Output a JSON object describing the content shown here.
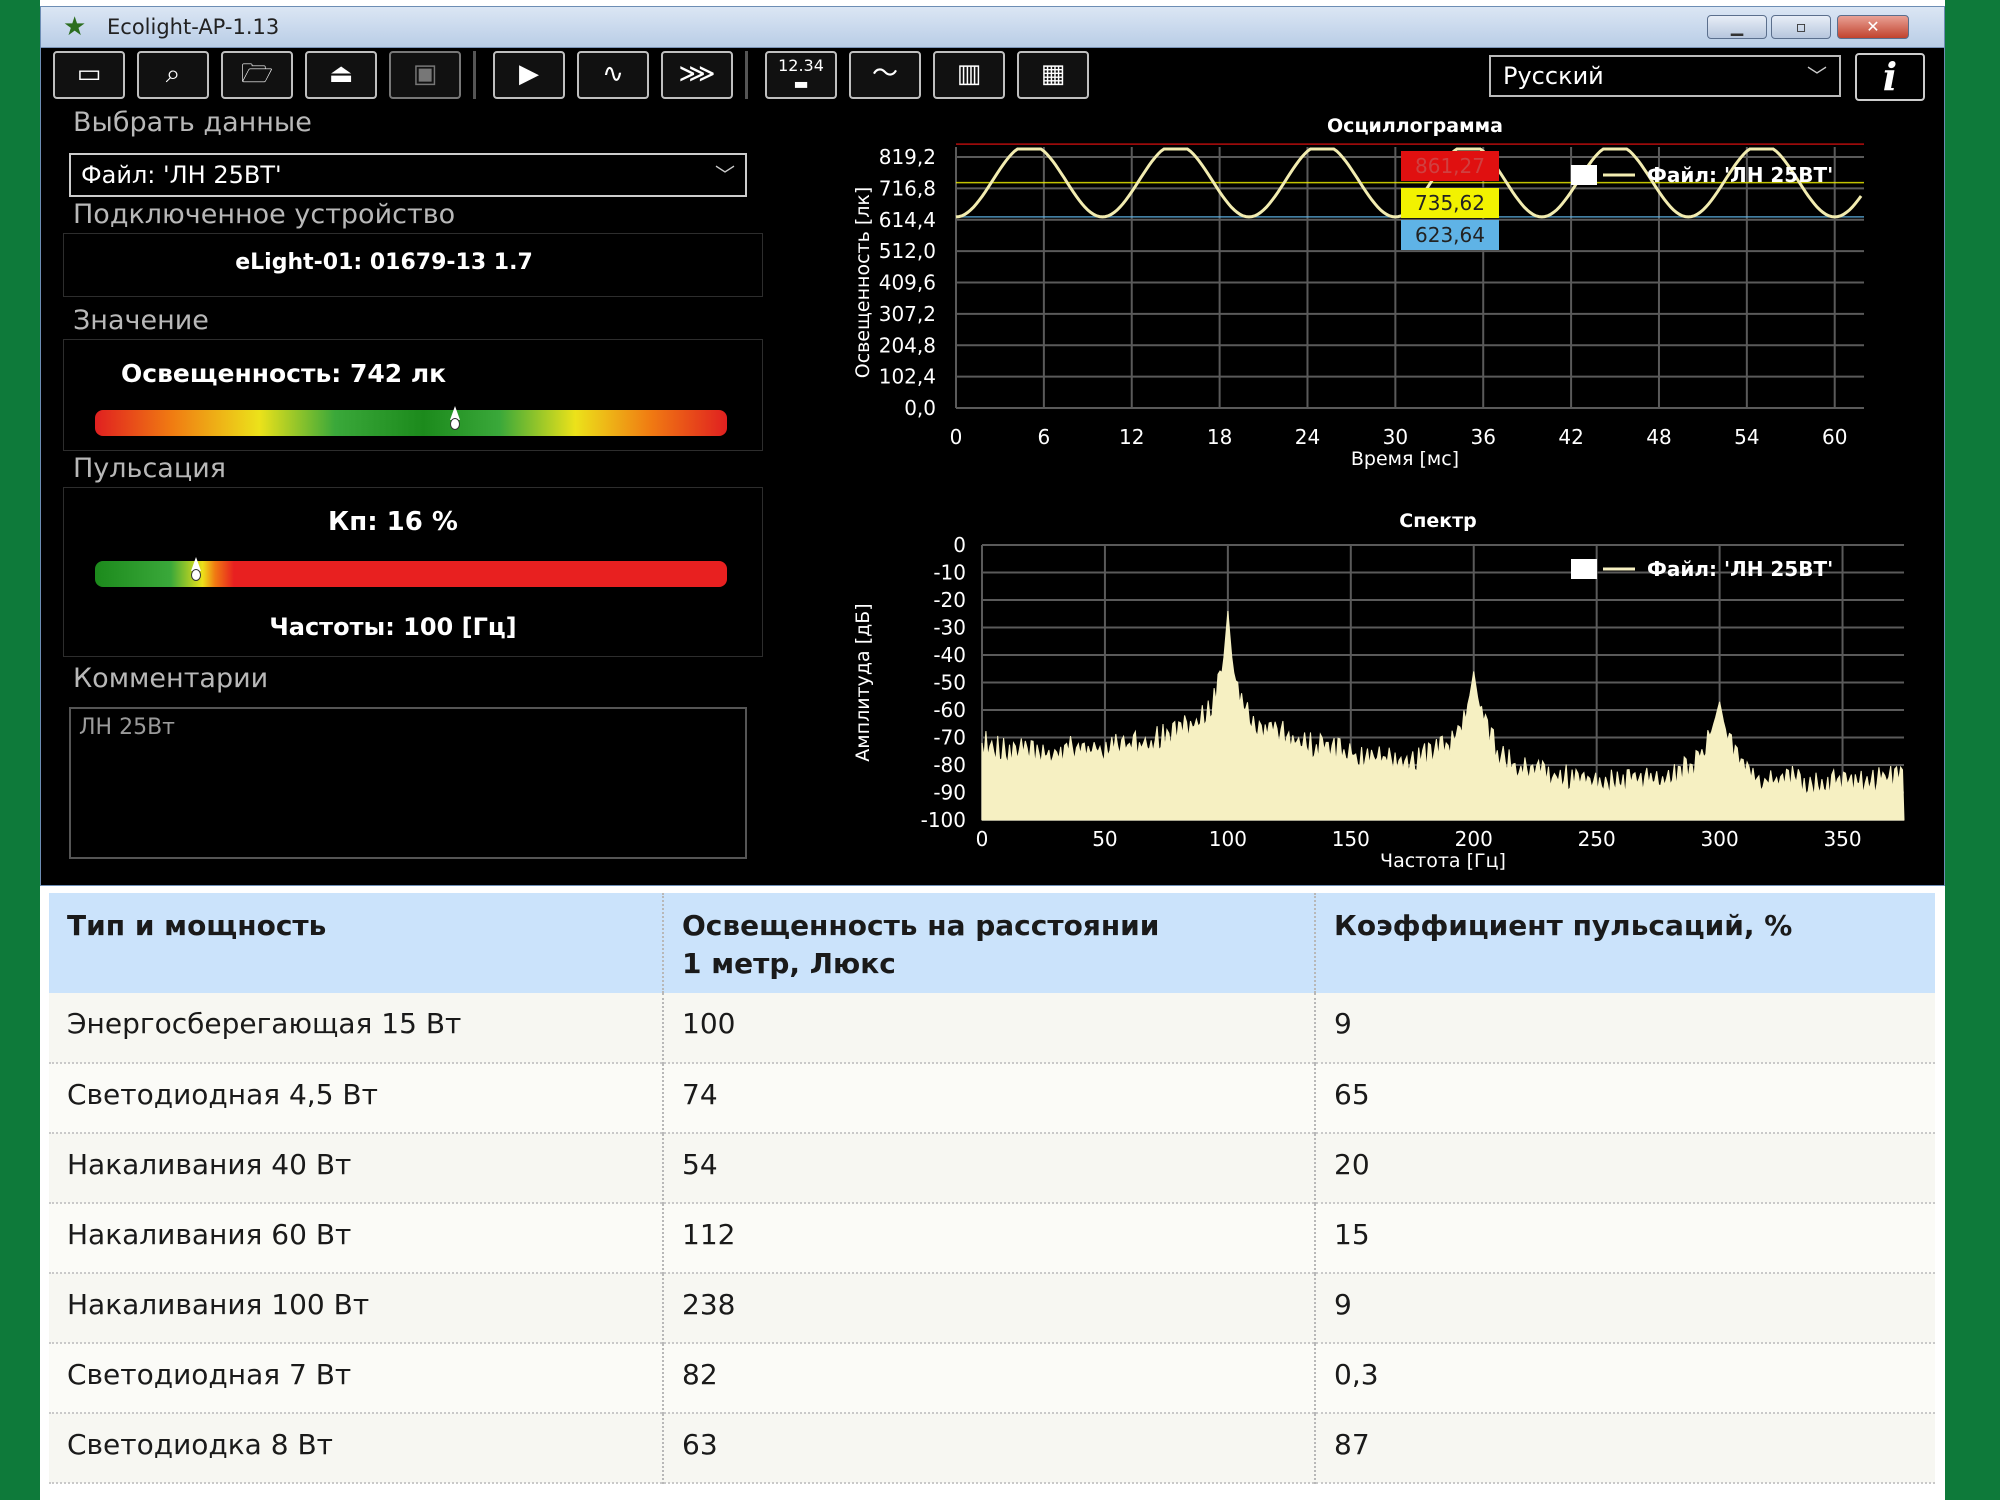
{
  "window": {
    "title": "Ecolight-AP-1.13"
  },
  "toolbar": {
    "language": "Русский",
    "info_label": "i",
    "buttons": [
      "new-window",
      "preview",
      "open-folder",
      "eject",
      "save",
      "play",
      "waveform-settings",
      "filter",
      "timer",
      "oscillogram",
      "spectrum",
      "layout"
    ]
  },
  "left": {
    "select_data_label": "Выбрать данные",
    "select_data_value": "Файл: 'ЛН 25ВТ'",
    "device_label": "Подключенное устройство",
    "device_value": "eLight-01: 01679-13 1.7",
    "value_label": "Значение",
    "illuminance_text": "Освещенность: 742 лк",
    "illuminance_gauge_fraction": 0.57,
    "pulsation_label": "Пульсация",
    "kp_text": "Кп: 16 %",
    "kp_gauge_fraction": 0.16,
    "frequency_text": "Частоты: 100 [Гц]",
    "comments_label": "Комментарии",
    "comments_value": "ЛН 25Вт"
  },
  "chart_data": [
    {
      "type": "line",
      "title": "Осциллограмма",
      "xlabel": "Время [мс]",
      "ylabel": "Освещенность [лк]",
      "xlim": [
        0,
        62
      ],
      "ylim": [
        0,
        819.2
      ],
      "xticks": [
        "0",
        "6",
        "12",
        "18",
        "24",
        "30",
        "36",
        "42",
        "48",
        "54",
        "60"
      ],
      "yticks": [
        "0,0",
        "102,4",
        "204,8",
        "307,2",
        "409,6",
        "512,0",
        "614,4",
        "716,8",
        "819,2"
      ],
      "series": [
        {
          "name": "Файл: 'ЛН 25ВТ'",
          "color": "#f2ecb0",
          "period_ms": 10,
          "max": 861.27,
          "mean": 735.62,
          "min": 623.64,
          "phase_peak_ms": 5
        }
      ],
      "markers": [
        {
          "label": "861,27",
          "value": 861.27,
          "color": "#e01010"
        },
        {
          "label": "735,62",
          "value": 735.62,
          "color": "#f2f200"
        },
        {
          "label": "623,64",
          "value": 623.64,
          "color": "#5fb3e6"
        }
      ],
      "grid": true,
      "legend": "top-right"
    },
    {
      "type": "area",
      "title": "Спектр",
      "xlabel": "Частота [Гц]",
      "ylabel": "Амплитуда [дБ]",
      "xlim": [
        0,
        375
      ],
      "ylim": [
        -100,
        0
      ],
      "xticks": [
        "0",
        "50",
        "100",
        "150",
        "200",
        "250",
        "300",
        "350"
      ],
      "yticks": [
        "0",
        "-10",
        "-20",
        "-30",
        "-40",
        "-50",
        "-60",
        "-70",
        "-80",
        "-90",
        "-100"
      ],
      "series": [
        {
          "name": "Файл: 'ЛН 25ВТ'",
          "color": "#f6f0c2",
          "x": [
            0,
            10,
            20,
            30,
            40,
            50,
            60,
            70,
            80,
            90,
            95,
            98,
            100,
            102,
            105,
            110,
            120,
            130,
            140,
            150,
            160,
            170,
            180,
            190,
            195,
            198,
            200,
            202,
            205,
            210,
            220,
            230,
            240,
            250,
            260,
            270,
            280,
            290,
            295,
            298,
            300,
            302,
            305,
            310,
            320,
            330,
            340,
            350,
            360,
            375
          ],
          "y": [
            -72,
            -75,
            -75,
            -75,
            -74,
            -74,
            -73,
            -71,
            -68,
            -62,
            -55,
            -45,
            -24,
            -45,
            -56,
            -64,
            -68,
            -72,
            -74,
            -76,
            -78,
            -78,
            -77,
            -72,
            -64,
            -57,
            -46,
            -58,
            -66,
            -76,
            -82,
            -83,
            -85,
            -86,
            -86,
            -86,
            -84,
            -80,
            -72,
            -64,
            -57,
            -66,
            -74,
            -82,
            -86,
            -85,
            -87,
            -86,
            -86,
            -85
          ]
        }
      ],
      "peaks": [
        {
          "x": 100,
          "y": -24
        },
        {
          "x": 200,
          "y": -46
        },
        {
          "x": 300,
          "y": -57
        }
      ],
      "grid": true,
      "legend": "top-right"
    }
  ],
  "table": {
    "headers": [
      "Тип и мощность",
      "Освещенность на расстоянии 1 метр, Люкс",
      "Коэффициент пульсаций, %"
    ],
    "header2_line1": "Освещенность на расстоянии",
    "header2_line2": "1 метр, Люкс",
    "rows": [
      [
        "Энергосберегающая 15 Вт",
        "100",
        "9"
      ],
      [
        "Светодиодная 4,5 Вт",
        "74",
        "65"
      ],
      [
        "Накаливания 40 Вт",
        "54",
        "20"
      ],
      [
        "Накаливания 60 Вт",
        "112",
        "15"
      ],
      [
        "Накаливания 100 Вт",
        "238",
        "9"
      ],
      [
        "Светодиодная 7 Вт",
        "82",
        "0,3"
      ],
      [
        "Светодиодка 8 Вт",
        "63",
        "87"
      ]
    ]
  }
}
